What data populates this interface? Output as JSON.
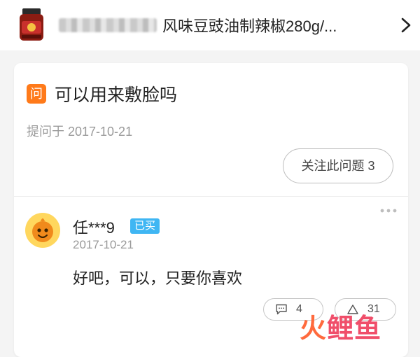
{
  "product": {
    "title": "风味豆豉油制辣椒280g/..."
  },
  "question": {
    "badge": "问",
    "title": "可以用来敷脸吗",
    "date": "提问于 2017-10-21",
    "follow_label": "关注此问题 3"
  },
  "answer": {
    "user": "任***9",
    "badge": "已买",
    "date": "2017-10-21",
    "text": "好吧，可以，只要你喜欢",
    "comment_count": "4",
    "like_count": "31"
  },
  "watermark": {
    "part1": "火",
    "part2": "鲤鱼"
  },
  "colors": {
    "question_badge": "#ff7a1a",
    "bought_badge": "#3fb6f3"
  }
}
